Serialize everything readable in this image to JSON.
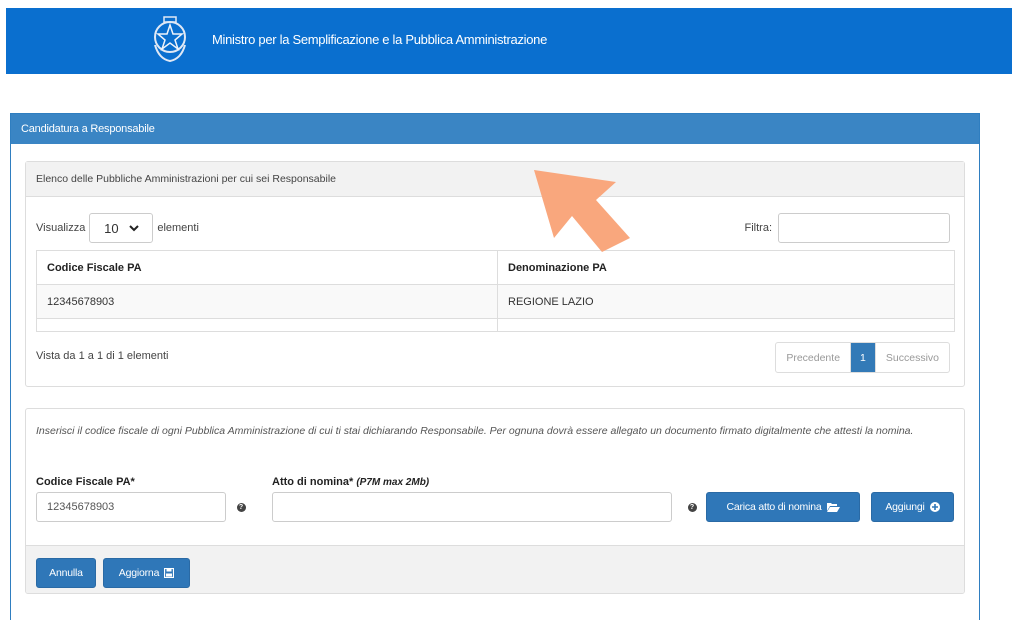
{
  "header": {
    "title": "Ministro per la Semplificazione e la Pubblica Amministrazione"
  },
  "panel": {
    "title": "Candidatura a Responsabile"
  },
  "list": {
    "title": "Elenco delle Pubbliche Amministrazioni per cui sei Responsabile",
    "show_label": "Visualizza",
    "page_size": "10",
    "elements_label": "elementi",
    "filter_label": "Filtra:",
    "columns": [
      "Codice Fiscale PA",
      "Denominazione PA"
    ],
    "rows": [
      [
        "12345678903",
        "REGIONE LAZIO"
      ]
    ],
    "info": "Vista da 1 a 1 di 1 elementi",
    "pager": {
      "prev": "Precedente",
      "current": "1",
      "next": "Successivo"
    }
  },
  "form": {
    "hint": "Inserisci il codice fiscale di ogni Pubblica Amministrazione di cui ti stai dichiarando Responsabile. Per ognuna dovrà essere allegato un documento firmato digitalmente che attesti la nomina.",
    "cf_label": "Codice Fiscale PA*",
    "cf_value": "12345678903",
    "atto_label": "Atto di nomina*",
    "atto_note": "(P7M max 2Mb)",
    "atto_value": "",
    "upload_button": "Carica atto di nomina",
    "add_button": "Aggiungi",
    "cancel_button": "Annulla",
    "update_button": "Aggiorna"
  },
  "colors": {
    "header_bg": "#0a6fcf",
    "panel_head": "#3a85c4",
    "button": "#2f77b8",
    "cursor": "#f9a77d"
  },
  "icons": [
    "emblem-icon",
    "chevron-down-icon",
    "question-icon",
    "folder-open-icon",
    "plus-circle-icon",
    "save-icon",
    "cursor-arrow-icon"
  ]
}
